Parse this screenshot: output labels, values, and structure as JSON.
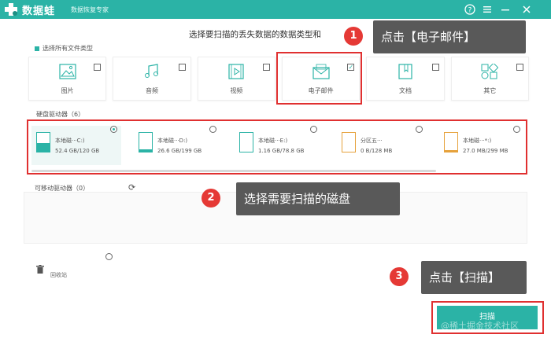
{
  "app": {
    "name": "数据蛙",
    "subtitle": "数据恢复专家"
  },
  "instruction": "选择要扫描的丢失数据的数据类型和",
  "select_all_label": "选择所有文件类型",
  "file_types": [
    {
      "label": "图片",
      "icon": "image-icon",
      "checked": false
    },
    {
      "label": "音频",
      "icon": "music-icon",
      "checked": false
    },
    {
      "label": "视频",
      "icon": "video-icon",
      "checked": false
    },
    {
      "label": "电子邮件",
      "icon": "email-icon",
      "checked": true
    },
    {
      "label": "文档",
      "icon": "document-icon",
      "checked": false
    },
    {
      "label": "其它",
      "icon": "other-icon",
      "checked": false
    }
  ],
  "disk_section_title": "硬盘驱动器（6）",
  "disks": [
    {
      "name": "本地磁···C:)",
      "size": "52.4 GB/120 GB",
      "fill": 0.44,
      "color": "#2bb3a6",
      "selected": true
    },
    {
      "name": "本地磁···D:)",
      "size": "26.6 GB/199 GB",
      "fill": 0.13,
      "color": "#2bb3a6",
      "selected": false
    },
    {
      "name": "本地磁···E:)",
      "size": "1.16 GB/78.8 GB",
      "fill": 0.02,
      "color": "#2bb3a6",
      "selected": false
    },
    {
      "name": "分区五···",
      "size": "0 B/128 MB",
      "fill": 0.0,
      "color": "#e6a23c",
      "selected": false
    },
    {
      "name": "本地磁···*:)",
      "size": "27.0 MB/299 MB",
      "fill": 0.09,
      "color": "#e6a23c",
      "selected": false
    }
  ],
  "removable_title": "可移动驱动器（0）",
  "recycle_label": "回收站",
  "scan_label": "扫描",
  "watermark": "@稀土掘金技术社区",
  "callouts": [
    {
      "num": "1",
      "text": "点击【电子邮件】"
    },
    {
      "num": "2",
      "text": "选择需要扫描的磁盘"
    },
    {
      "num": "3",
      "text": "点击【扫描】"
    }
  ],
  "colors": {
    "accent": "#2bb3a6",
    "highlight": "#e03030",
    "callout_bg": "#595959",
    "badge": "#e53935"
  }
}
